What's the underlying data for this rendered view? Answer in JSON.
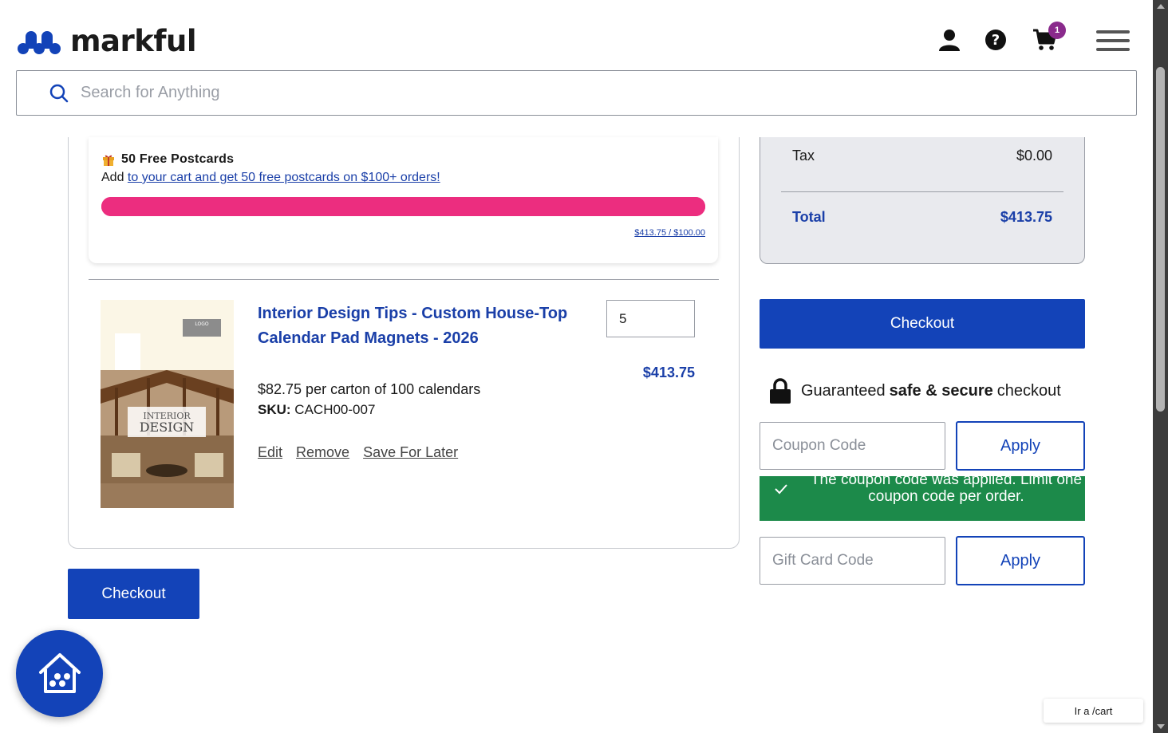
{
  "header": {
    "logo_text": "markful",
    "cart_count": "1",
    "icons": [
      "account-icon",
      "help-icon",
      "cart-icon",
      "menu-icon"
    ]
  },
  "search": {
    "placeholder": "Search for Anything",
    "value": ""
  },
  "promo": {
    "title": "50 Free Postcards",
    "text_prefix": "Add ",
    "link_text": "to your cart and get 50 free postcards on $100+ orders!",
    "progress_label": "$413.75 / $100.00",
    "progress_fraction": 1.0,
    "progress_color": "#ec2d7f"
  },
  "cart_item": {
    "image_logo_text": "LOGO",
    "image_title_line1": "INTERIOR",
    "image_title_line2": "DESIGN",
    "name": "Interior Design Tips - Custom House-Top Calendar Pad Magnets - 2026",
    "quantity": "5",
    "price": "$413.75",
    "unit_description": "$82.75 per carton of 100 calendars",
    "sku_label": "SKU:",
    "sku_value": "CACH00-007",
    "actions": {
      "edit": "Edit",
      "remove": "Remove",
      "save_for_later": "Save For Later"
    }
  },
  "checkout_left_label": "Checkout",
  "summary": {
    "tax_label": "Tax",
    "tax_value": "$0.00",
    "total_label": "Total",
    "total_value": "$413.75"
  },
  "checkout_right_label": "Checkout",
  "secure": {
    "prefix": "Guaranteed ",
    "bold": "safe & secure",
    "suffix": " checkout"
  },
  "coupon": {
    "placeholder": "Coupon Code",
    "apply_label": "Apply",
    "success_message": "The coupon code was applied. Limit one coupon code per order."
  },
  "gift_card": {
    "placeholder": "Gift Card Code",
    "apply_label": "Apply"
  },
  "url_chip": "Ir a /cart",
  "colors": {
    "brand_blue": "#1343b8",
    "link_blue": "#1a3fa8",
    "success_green": "#1c8a4a",
    "badge_purple": "#8a2a8c"
  }
}
